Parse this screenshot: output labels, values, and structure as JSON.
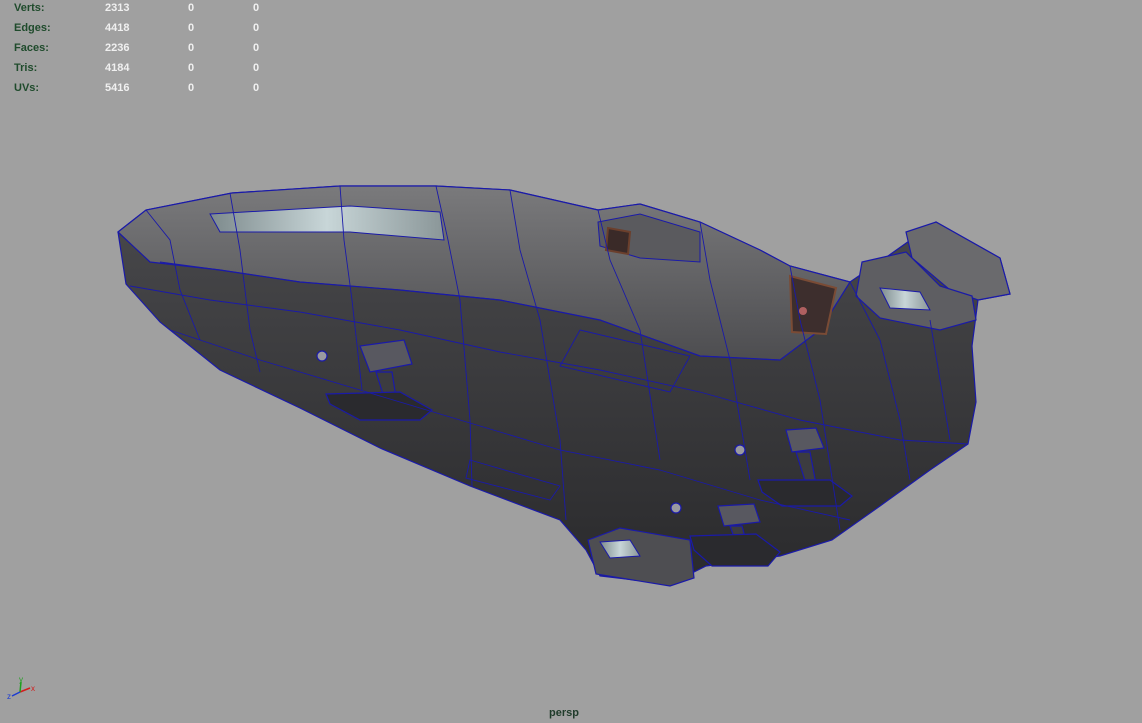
{
  "hud": {
    "rows": [
      {
        "label": "Verts:",
        "values": [
          "2313",
          "0",
          "0"
        ]
      },
      {
        "label": "Edges:",
        "values": [
          "4418",
          "0",
          "0"
        ]
      },
      {
        "label": "Faces:",
        "values": [
          "2236",
          "0",
          "0"
        ]
      },
      {
        "label": "Tris:",
        "values": [
          "4184",
          "0",
          "0"
        ]
      },
      {
        "label": "UVs:",
        "values": [
          "5416",
          "0",
          "0"
        ]
      }
    ]
  },
  "viewport": {
    "camera": "persp",
    "background_color": "#a0a0a0",
    "wireframe_color": "#1a1aa8"
  },
  "axis_gizmo": {
    "x_label": "x",
    "y_label": "y",
    "z_label": "z",
    "x_color": "#d21c1c",
    "y_color": "#1ca01c",
    "z_color": "#1c3cd2"
  }
}
